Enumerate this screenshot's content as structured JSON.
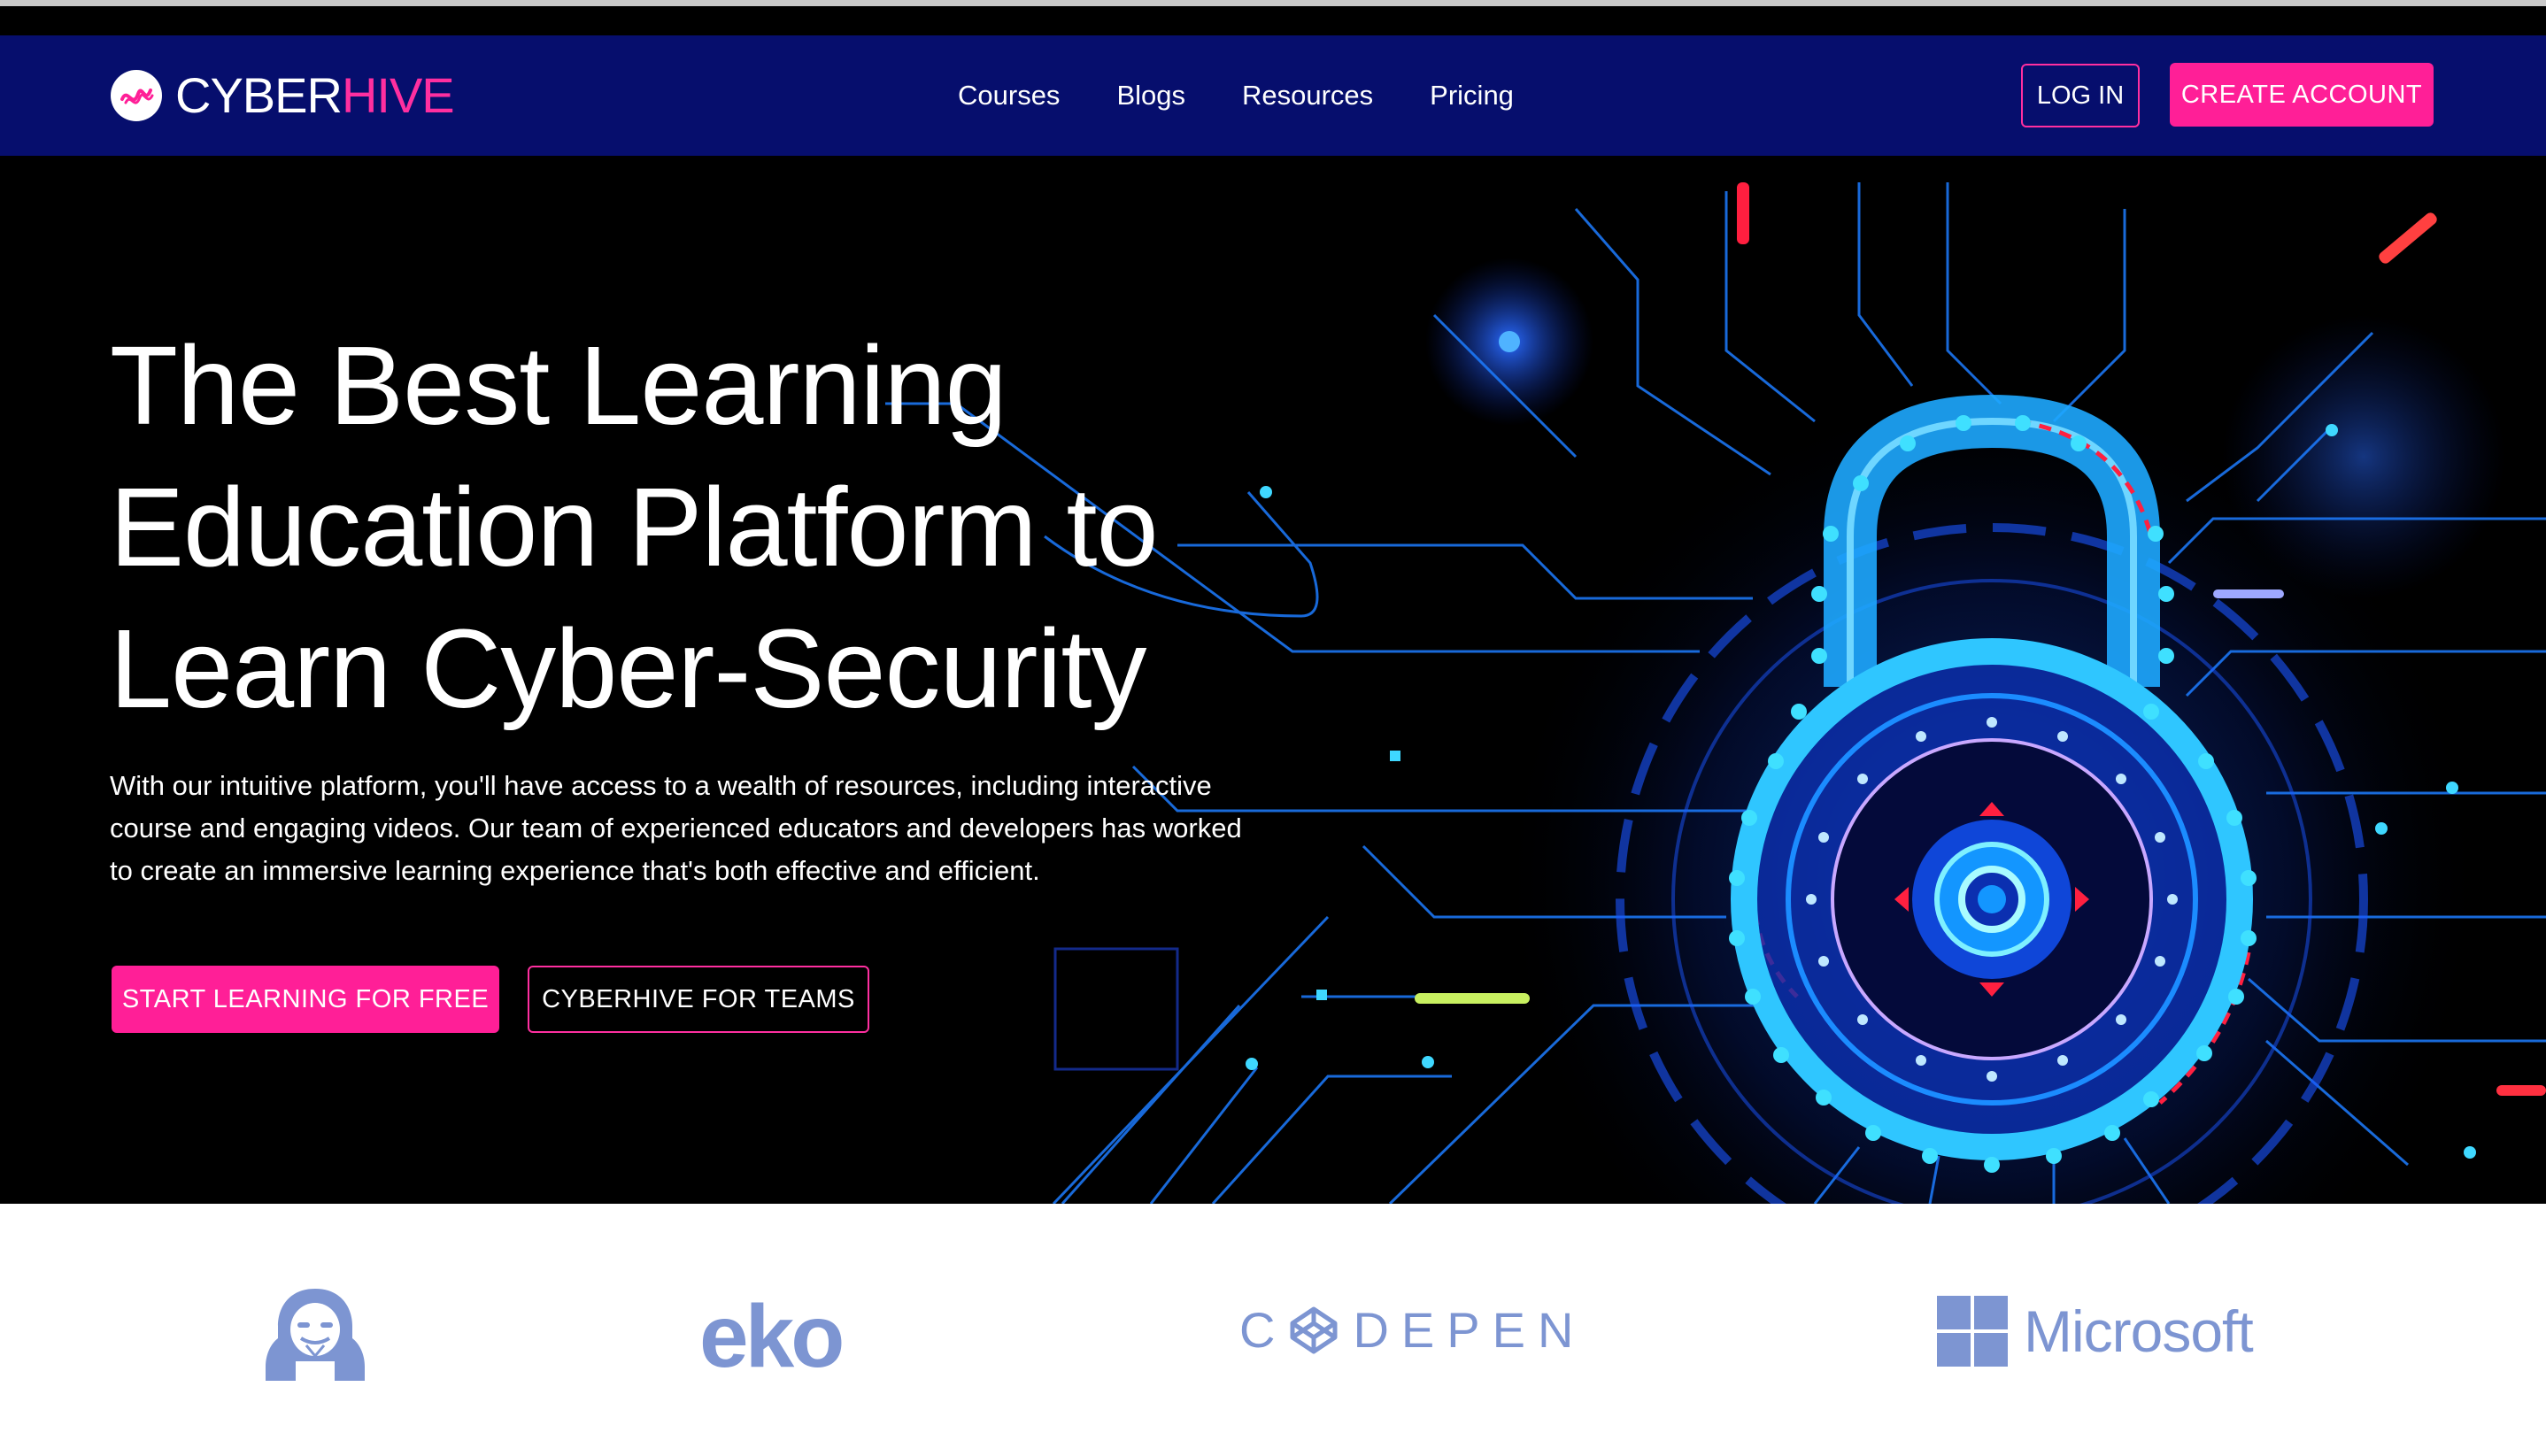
{
  "brand": {
    "name_part1": "CYBER",
    "name_part2": "HIVE",
    "accent_color": "#ff1f97",
    "nav_color": "#060e6d",
    "logo_icon": "wave-circle-icon"
  },
  "nav": {
    "links": [
      "Courses",
      "Blogs",
      "Resources",
      "Pricing"
    ],
    "login_label": "LOG IN",
    "create_account_label": "CREATE ACCOUNT"
  },
  "hero": {
    "title_lines": [
      "The Best Learning",
      "Education Platform to",
      "Learn Cyber-Security"
    ],
    "description": "With our intuitive platform, you'll have access to a wealth of resources, including interactive course and engaging videos. Our team of experienced educators and developers has worked to create an immersive learning experience that's both effective and efficient.",
    "primary_cta": "START LEARNING FOR FREE",
    "secondary_cta": "CYBERHIVE FOR TEAMS",
    "illustration": "circuit-padlock-icon"
  },
  "partners": {
    "color": "#7d95d2",
    "items": [
      {
        "name": "",
        "icon": "hacker-icon"
      },
      {
        "name": "eko",
        "icon": ""
      },
      {
        "name": "C",
        "name_rest": "DEPEN",
        "icon": "codepen-icon"
      },
      {
        "name": "Microsoft",
        "icon": "microsoft-windows-icon"
      }
    ]
  }
}
